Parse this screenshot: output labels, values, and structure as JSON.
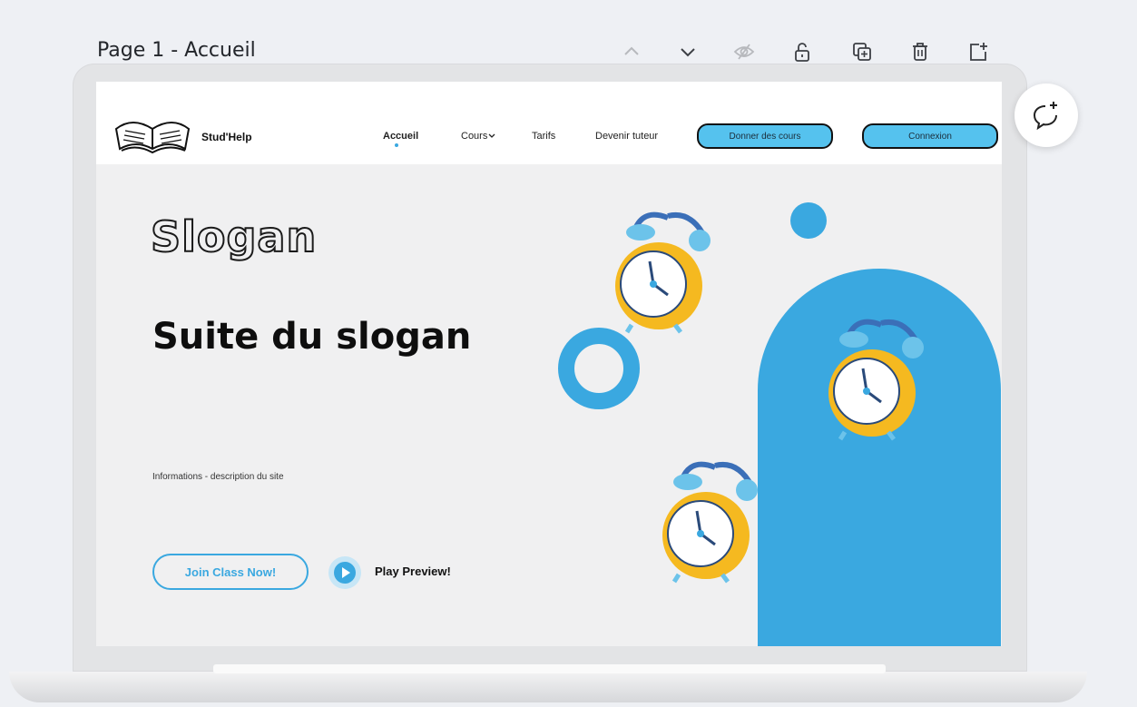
{
  "page": {
    "label": "Page 1 - Accueil"
  },
  "toolbar": {
    "icons": [
      "chevron-up-icon",
      "chevron-down-icon",
      "hide-icon",
      "unlock-icon",
      "duplicate-icon",
      "trash-icon",
      "add-page-icon"
    ]
  },
  "site": {
    "brand": "Stud'Help",
    "nav": {
      "items": [
        "Accueil",
        "Cours",
        "Tarifs",
        "Devenir tuteur"
      ],
      "active": "Accueil",
      "btn_give": "Donner des cours",
      "btn_login": "Connexion"
    },
    "hero": {
      "slogan": "Slogan",
      "subslogan": "Suite du slogan",
      "info": "Informations - description du site",
      "join": "Join Class Now!",
      "play": "Play Preview!"
    }
  },
  "colors": {
    "accent": "#3aa8e0",
    "button": "#55c2ee",
    "clock": "#f5b920"
  }
}
